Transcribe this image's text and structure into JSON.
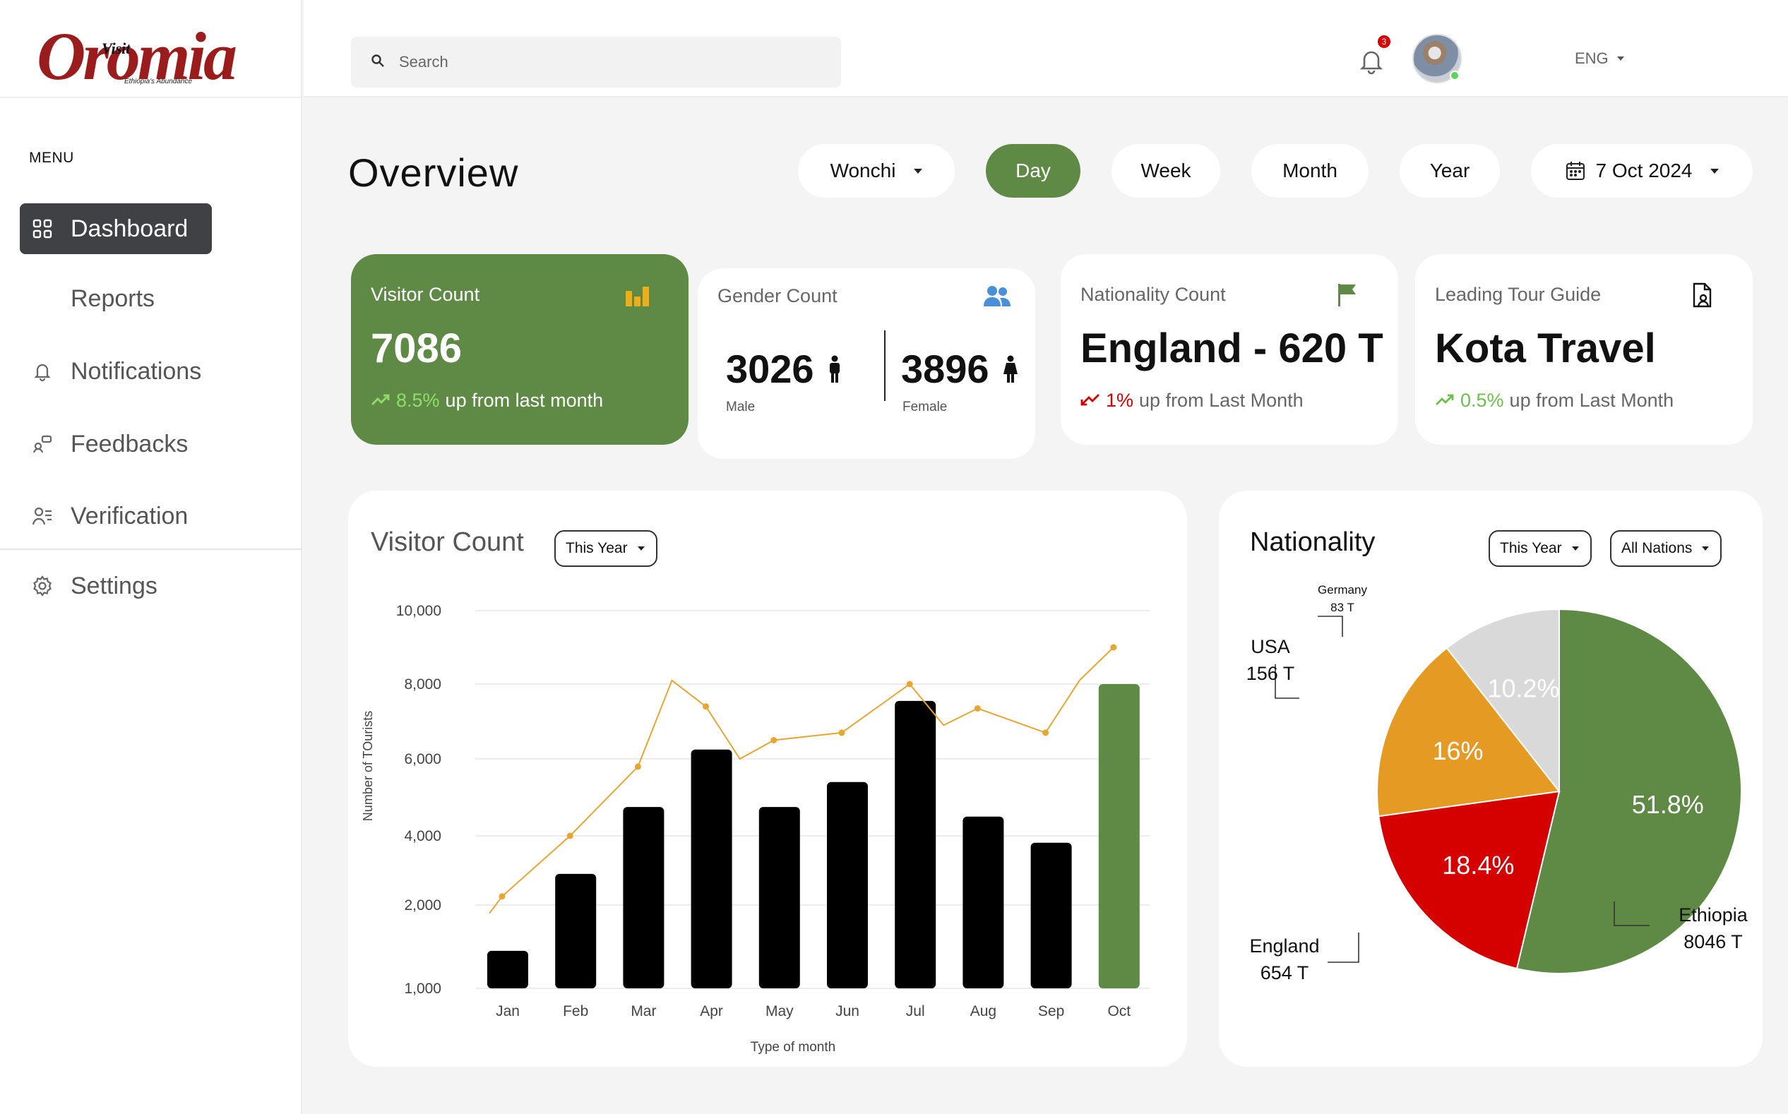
{
  "brand": {
    "visit": "Visit",
    "name": "Oromia",
    "tagline": "Ethiopia's Abundance"
  },
  "sidebar": {
    "menu_caption": "MENU",
    "items": [
      {
        "label": "Dashboard",
        "icon": "grid-icon",
        "active": true
      },
      {
        "label": "Reports",
        "icon": "",
        "active": false
      },
      {
        "label": "Notifications",
        "icon": "bell-icon",
        "active": false
      },
      {
        "label": "Feedbacks",
        "icon": "feedback-icon",
        "active": false
      },
      {
        "label": "Verification",
        "icon": "user-check-icon",
        "active": false
      },
      {
        "label": "Settings",
        "icon": "gear-icon",
        "active": false
      }
    ]
  },
  "header": {
    "search_placeholder": "Search",
    "language": "ENG",
    "notification_count": "3"
  },
  "overview": {
    "title": "Overview",
    "location": "Wonchi",
    "periods": [
      "Day",
      "Week",
      "Month",
      "Year"
    ],
    "active_period": "Day",
    "date": "7 Oct 2024"
  },
  "cards": {
    "visitor": {
      "label": "Visitor Count",
      "value": "7086",
      "change": "8.5%",
      "change_text": "up from last month"
    },
    "gender": {
      "label": "Gender Count",
      "male_value": "3026",
      "male_label": "Male",
      "female_value": "3896",
      "female_label": "Female"
    },
    "nationality": {
      "label": "Nationality Count",
      "value": "England - 620 T",
      "change": "1%",
      "change_text": "up from Last Month"
    },
    "guide": {
      "label": "Leading Tour Guide",
      "value": "Kota Travel",
      "change": "0.5%",
      "change_text": "up from Last Month"
    }
  },
  "colors": {
    "accent_green": "#5f8a46",
    "gold": "#e59b23",
    "red": "#d50000",
    "grey": "#d9d9d9",
    "line": "#e6a732"
  },
  "visitor_chart": {
    "title": "Visitor Count",
    "filter": "This Year"
  },
  "nationality_chart": {
    "title": "Nationality",
    "filter": "This Year",
    "scope": "All Nations"
  },
  "chart_data": [
    {
      "type": "bar",
      "categories": [
        "Jan",
        "Feb",
        "Mar",
        "Apr",
        "May",
        "Jun",
        "Jul",
        "Aug",
        "Sep",
        "Oct"
      ],
      "series": [
        {
          "values": [
            1450,
            2900,
            4750,
            6250,
            4750,
            5400,
            7550,
            4500,
            3800,
            8000
          ]
        },
        {
          "values": [
            2250,
            4000,
            5800,
            7400,
            6500,
            6700,
            8000,
            7350,
            6700,
            9000
          ]
        }
      ],
      "xlabel": "Type of month",
      "ylabel": "Number of TOurists",
      "yticks": [
        "10,000",
        "8,000",
        "6,000",
        "4,000",
        "2,000",
        "1,000"
      ],
      "ylim": [
        1000,
        10000
      ],
      "line_type": "line",
      "extra_line_points": [
        {
          "after": "Mar",
          "value": 8100
        },
        {
          "after": "Apr",
          "value": 6000
        },
        {
          "after": "Jul",
          "value": 6900
        },
        {
          "after": "Sep",
          "value": 8100
        }
      ],
      "highlight_category": "Oct",
      "start_value": 1900,
      "legend": "none",
      "grid": true
    },
    {
      "type": "pie",
      "slices": [
        {
          "name": "Ethiopia",
          "value": 51.8,
          "label": "51.8%",
          "callout": [
            "Ethiopia",
            "8046 T"
          ],
          "color": "#5f8a46"
        },
        {
          "name": "England",
          "value": 18.4,
          "label": "18.4%",
          "callout": [
            "England",
            "654 T"
          ],
          "color": "#d50000"
        },
        {
          "name": "USA",
          "value": 16,
          "label": "16%",
          "callout": [
            "USA",
            "156 T"
          ],
          "color": "#e59b23"
        },
        {
          "name": "Germany",
          "value": 10.2,
          "label": "10.2%",
          "callout": [
            "Germany",
            "83 T"
          ],
          "color": "#d9d9d9"
        }
      ]
    }
  ]
}
